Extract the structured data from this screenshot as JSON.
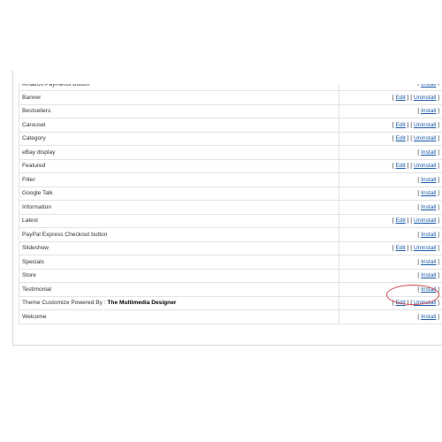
{
  "modules": [
    {
      "name": "Amazon Payments Button",
      "actions": [
        "Install"
      ]
    },
    {
      "name": "Banner",
      "actions": [
        "Edit",
        "Uninstall"
      ]
    },
    {
      "name": "Bestsellers",
      "actions": [
        "Install"
      ]
    },
    {
      "name": "Carousel",
      "actions": [
        "Edit",
        "Uninstall"
      ]
    },
    {
      "name": "Category",
      "actions": [
        "Edit",
        "Uninstall"
      ]
    },
    {
      "name": "eBay display",
      "actions": [
        "Install"
      ]
    },
    {
      "name": "Featured",
      "actions": [
        "Edit",
        "Uninstall"
      ]
    },
    {
      "name": "Filter",
      "actions": [
        "Install"
      ]
    },
    {
      "name": "Google Talk",
      "actions": [
        "Install"
      ]
    },
    {
      "name": "Information",
      "actions": [
        "Install"
      ]
    },
    {
      "name": "Latest",
      "actions": [
        "Edit",
        "Uninstall"
      ]
    },
    {
      "name": "PayPal Express Checkout button",
      "actions": [
        "Install"
      ]
    },
    {
      "name": "Slideshow",
      "actions": [
        "Edit",
        "Uninstall"
      ]
    },
    {
      "name": "Specials",
      "actions": [
        "Install"
      ]
    },
    {
      "name": "Store",
      "actions": [
        "Install"
      ]
    },
    {
      "name": "Testimonial",
      "actions": [
        "Install"
      ]
    },
    {
      "name": "Theme Customize Powered By :",
      "name_brand": "The Multimedia Designer",
      "actions": [
        "Edit",
        "Uninstall"
      ]
    },
    {
      "name": "Welcome",
      "actions": [
        "Install"
      ]
    }
  ],
  "highlight": {
    "module": "Testimonial",
    "color": "#d0474f"
  },
  "colors": {
    "link": "#1a5aa8",
    "border": "#e3e3e3"
  }
}
